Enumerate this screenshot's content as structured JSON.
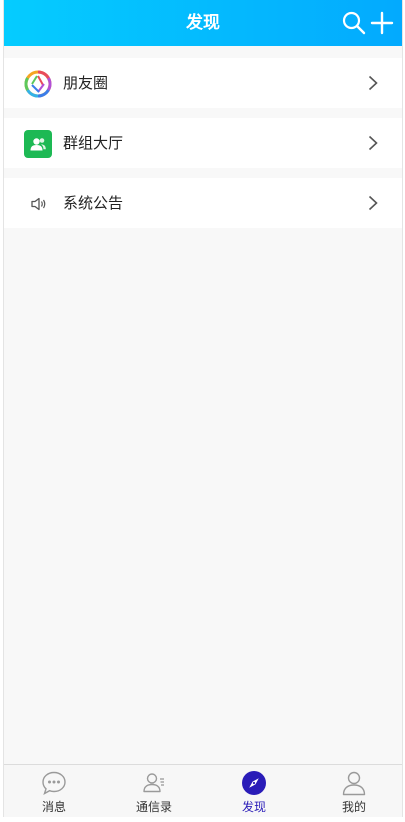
{
  "header": {
    "title": "发现",
    "search_icon": "search-icon",
    "add_icon": "plus-icon"
  },
  "menu": [
    {
      "label": "朋友圈",
      "icon": "moments-aperture-icon"
    },
    {
      "label": "群组大厅",
      "icon": "group-hall-icon"
    },
    {
      "label": "系统公告",
      "icon": "speaker-icon"
    }
  ],
  "tabbar": {
    "items": [
      {
        "label": "消息",
        "icon": "chat-bubble-icon"
      },
      {
        "label": "通信录",
        "icon": "contacts-icon"
      },
      {
        "label": "发现",
        "icon": "compass-icon"
      },
      {
        "label": "我的",
        "icon": "user-icon"
      }
    ],
    "active": "发现"
  },
  "colors": {
    "header_gradient_start": "#05ccff",
    "header_gradient_end": "#03aafe",
    "active_tab": "#2a1cb8",
    "group_icon_bg": "#1db954",
    "page_bg": "#f8f8f8"
  }
}
